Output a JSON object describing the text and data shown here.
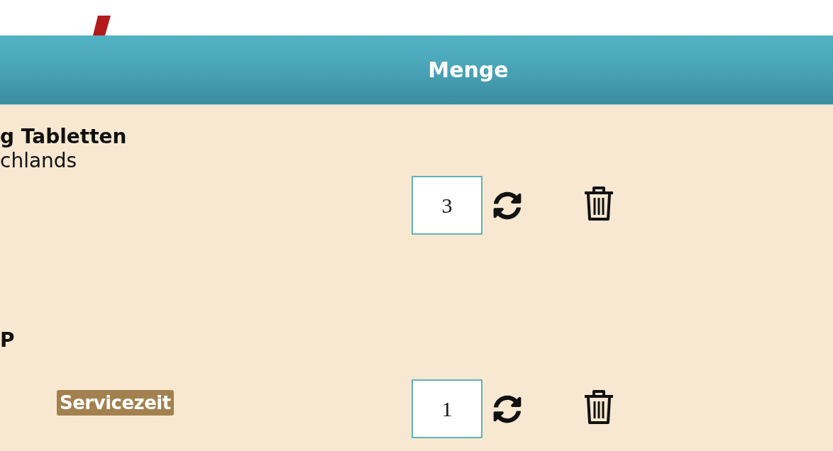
{
  "table": {
    "columns": [
      {
        "label": "Menge"
      }
    ],
    "rows": [
      {
        "product": {
          "name": "g Tabletten",
          "detail": "chlands"
        },
        "quantity": "3"
      },
      {
        "product": {
          "name": "P"
        },
        "quantity": "1"
      }
    ]
  },
  "service_tab": {
    "label": "Servicezeit"
  }
}
